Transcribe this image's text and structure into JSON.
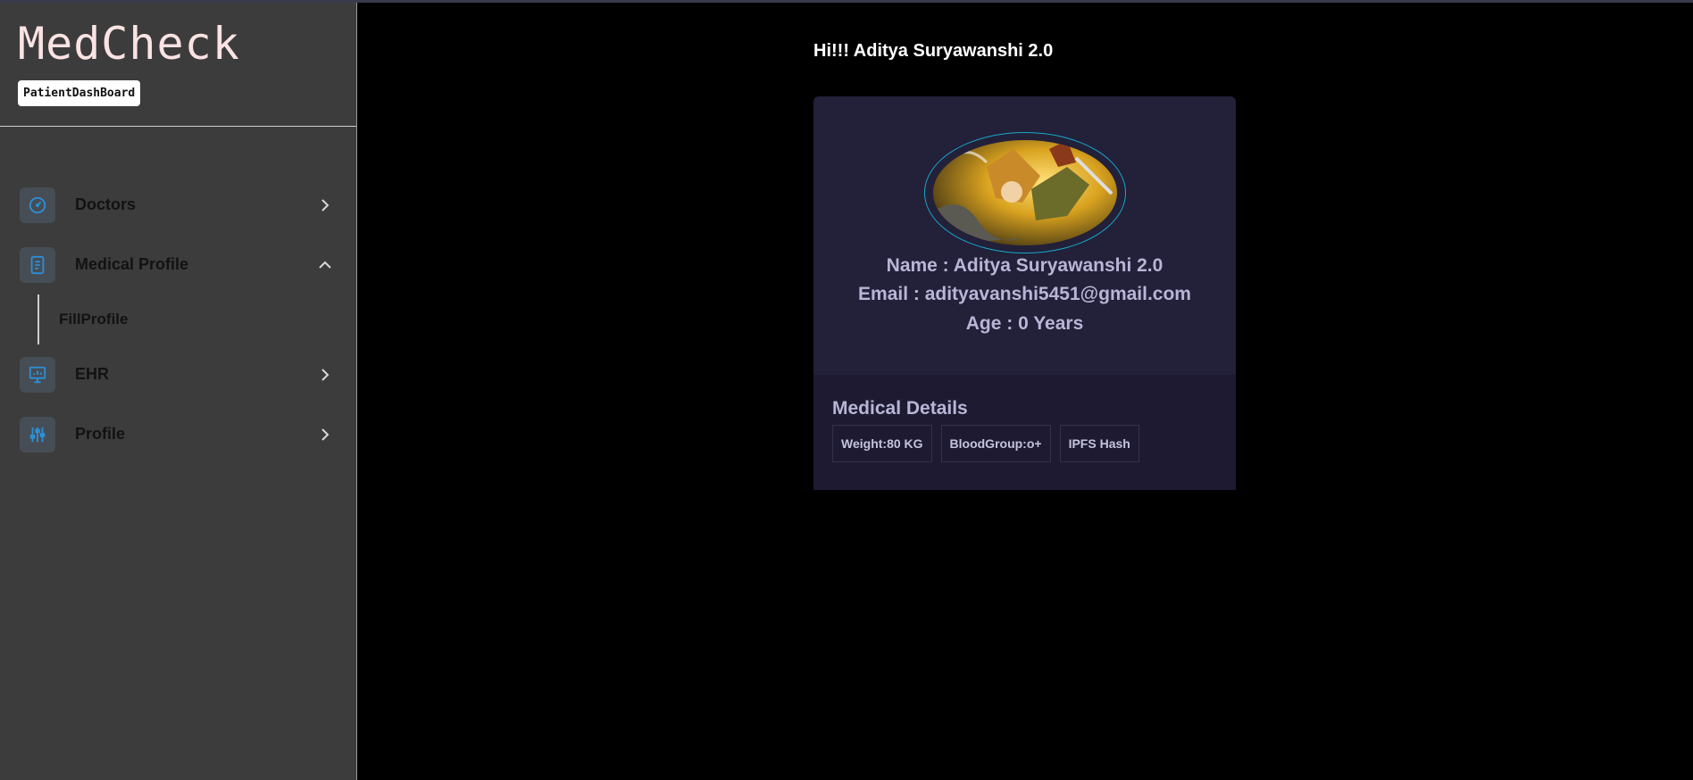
{
  "sidebar": {
    "brand": "MedCheck",
    "badge": "PatientDashBoard",
    "items": [
      {
        "label": "Doctors",
        "icon": "gauge-icon",
        "expanded": false
      },
      {
        "label": "Medical Profile",
        "icon": "document-icon",
        "expanded": true,
        "children": [
          {
            "label": "FillProfile"
          }
        ]
      },
      {
        "label": "EHR",
        "icon": "presentation-chart-icon",
        "expanded": false
      },
      {
        "label": "Profile",
        "icon": "sliders-icon",
        "expanded": false
      }
    ]
  },
  "main": {
    "greeting": "Hi!!! Aditya Suryawanshi 2.0",
    "profile": {
      "name_line": "Name : Aditya Suryawanshi 2.0",
      "email_line": "Email : adityavanshi5451@gmail.com",
      "age_line": "Age : 0 Years"
    },
    "medical_details": {
      "title": "Medical Details",
      "chips": [
        "Weight:80 KG",
        "BloodGroup:o+",
        "IPFS Hash"
      ]
    }
  },
  "colors": {
    "accent_icon": "#2c8fd6",
    "avatar_ring": "#17a8c8",
    "card_bg": "#232039",
    "sidebar_bg": "#3c3c3c"
  }
}
